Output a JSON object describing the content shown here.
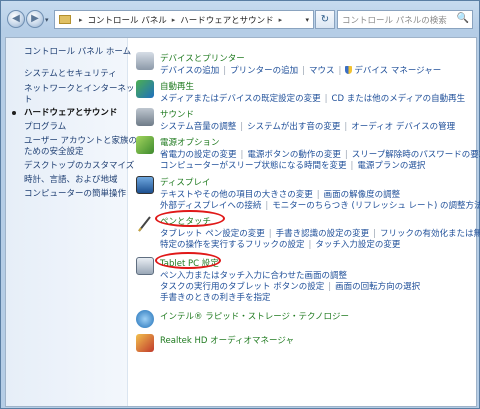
{
  "nav": {
    "back_glyph": "◀",
    "forward_glyph": "▶",
    "dropdown_glyph": "▾",
    "refresh_glyph": "↻"
  },
  "address": {
    "segments": [
      "コントロール パネル",
      "ハードウェアとサウンド"
    ],
    "separator": "▸",
    "dropdown_glyph": "▾"
  },
  "search": {
    "placeholder": "コントロール パネルの検索",
    "icon_glyph": "🔍"
  },
  "sidebar": {
    "items": [
      {
        "label": "コントロール パネル ホーム"
      },
      {
        "label": "システムとセキュリティ"
      },
      {
        "label": "ネットワークとインターネット"
      },
      {
        "label": "ト"
      },
      {
        "label": "ハードウェアとサウンド",
        "current": true
      },
      {
        "label": "プログラム"
      },
      {
        "label": "ユーザー アカウントと家族の"
      },
      {
        "label": "ための安全設定"
      },
      {
        "label": "デスクトップのカスタマイズ"
      },
      {
        "label": "時計、言語、および地域"
      },
      {
        "label": "コンピューターの簡単操作"
      }
    ]
  },
  "categories": [
    {
      "title": "デバイスとプリンター",
      "lines": [
        [
          "デバイスの追加",
          "プリンターの追加",
          "マウス",
          "デバイス マネージャー"
        ]
      ],
      "icon": "printer-icon"
    },
    {
      "title": "自動再生",
      "lines": [
        [
          "メディアまたはデバイスの既定設定の変更",
          "CD または他のメディアの自動再生"
        ]
      ],
      "icon": "autoplay-icon"
    },
    {
      "title": "サウンド",
      "lines": [
        [
          "システム音量の調整",
          "システムが出す音の変更",
          "オーディオ デバイスの管理"
        ]
      ],
      "icon": "sound-icon"
    },
    {
      "title": "電源オプション",
      "lines": [
        [
          "省電力の設定の変更",
          "電源ボタンの動作の変更",
          "スリープ解除時のパスワードの要求"
        ],
        [
          "コンピューターがスリープ状態になる時間を変更",
          "電源プランの選択"
        ]
      ],
      "icon": "power-icon"
    },
    {
      "title": "ディスプレイ",
      "lines": [
        [
          "テキストやその他の項目の大きさの変更",
          "画面の解像度の調整"
        ],
        [
          "外部ディスプレイへの接続",
          "モニターのちらつき (リフレッシュ レート) の調整方法"
        ]
      ],
      "icon": "display-icon"
    },
    {
      "title": "ペンとタッチ",
      "lines": [
        [
          "タブレット ペン設定の変更",
          "手書き認識の設定の変更",
          "フリックの有効化または無効化"
        ],
        [
          "特定の操作を実行するフリックの設定",
          "タッチ入力設定の変更"
        ]
      ],
      "icon": "pen-icon"
    },
    {
      "title": "Tablet PC 設定",
      "lines": [
        [
          "ペン入力またはタッチ入力に合わせた画面の調整"
        ],
        [
          "タスクの実行用のタブレット ボタンの設定",
          "画面の回転方向の選択"
        ],
        [
          "手書きのときの利き手を指定"
        ]
      ],
      "icon": "tablet-icon"
    },
    {
      "title": "インテル® ラピッド・ストレージ・テクノロジー",
      "lines": [],
      "icon": "intel-icon"
    },
    {
      "title": "Realtek HD オーディオマネージャ",
      "lines": [],
      "icon": "realtek-icon"
    }
  ],
  "colors": {
    "category_title": "#1f7a1f",
    "link": "#1f4f99",
    "highlight_ring": "#e01818"
  }
}
